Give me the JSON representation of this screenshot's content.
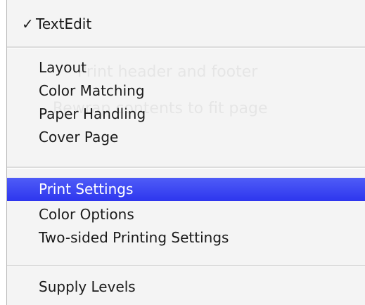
{
  "menu": {
    "groups": [
      [
        {
          "label": "TextEdit",
          "checked": true,
          "check_glyph": "✓"
        }
      ],
      [
        {
          "label": "Layout"
        },
        {
          "label": "Color Matching"
        },
        {
          "label": "Paper Handling"
        },
        {
          "label": "Cover Page"
        }
      ],
      [
        {
          "label": "Print Settings",
          "selected": true
        },
        {
          "label": "Color Options"
        },
        {
          "label": "Two-sided Printing Settings"
        }
      ],
      [
        {
          "label": "Supply Levels"
        }
      ]
    ],
    "selected_color": "#3a44f2"
  }
}
